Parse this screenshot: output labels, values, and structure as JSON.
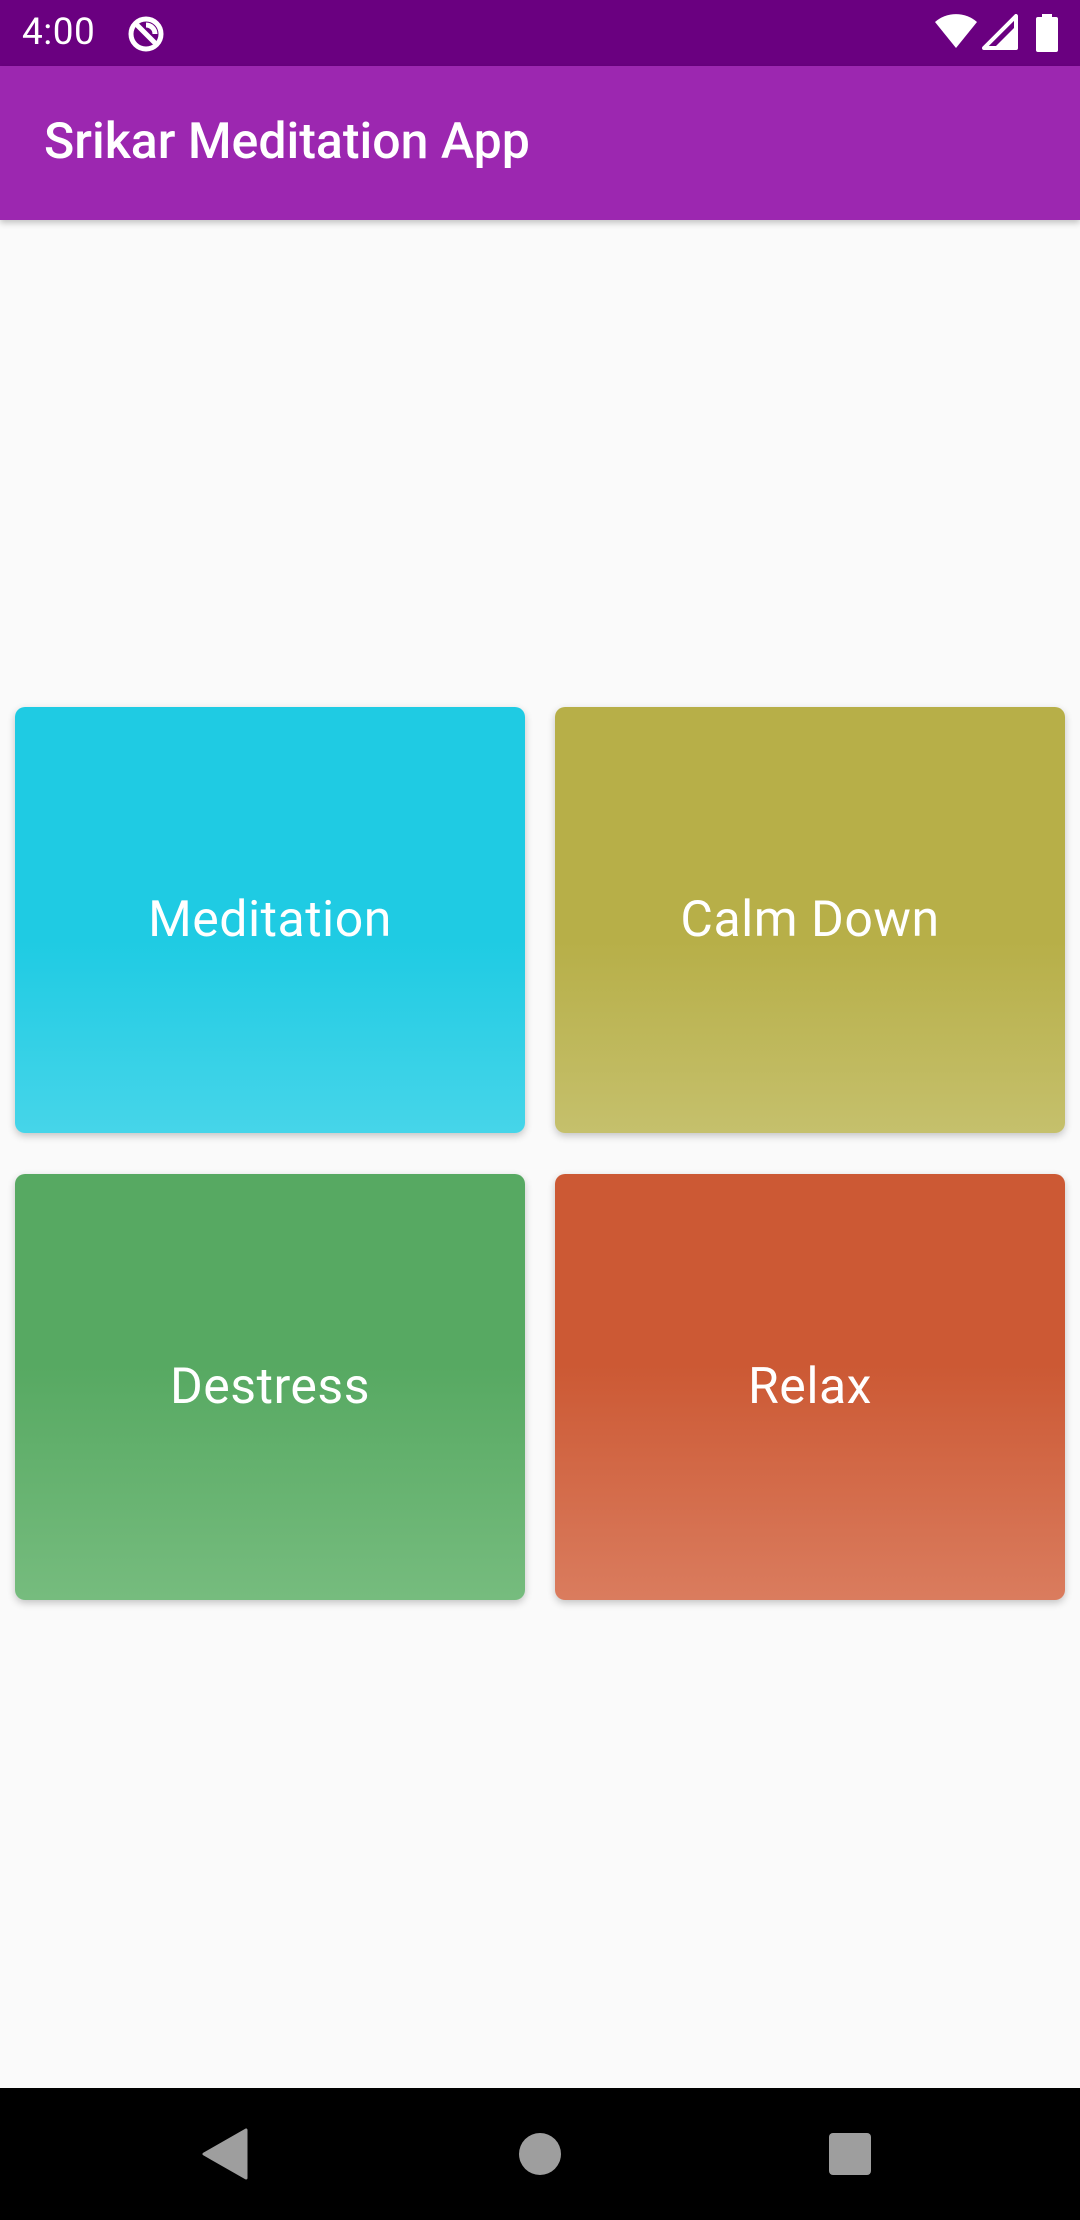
{
  "status_bar": {
    "time": "4:00",
    "icons": [
      "app-notification-icon",
      "wifi-icon",
      "cell-signal-icon",
      "battery-icon"
    ],
    "background": "#6a0080"
  },
  "app_bar": {
    "title": "Srikar Meditation App",
    "background": "#9c27b0"
  },
  "tiles": [
    {
      "label": "Meditation",
      "color": "#1fcbe3"
    },
    {
      "label": "Calm Down",
      "color": "#b7af48"
    },
    {
      "label": "Destress",
      "color": "#57a962"
    },
    {
      "label": "Relax",
      "color": "#cc5934"
    }
  ],
  "nav_bar": {
    "icons": [
      "back-icon",
      "home-icon",
      "recents-icon"
    ],
    "background": "#000000"
  }
}
